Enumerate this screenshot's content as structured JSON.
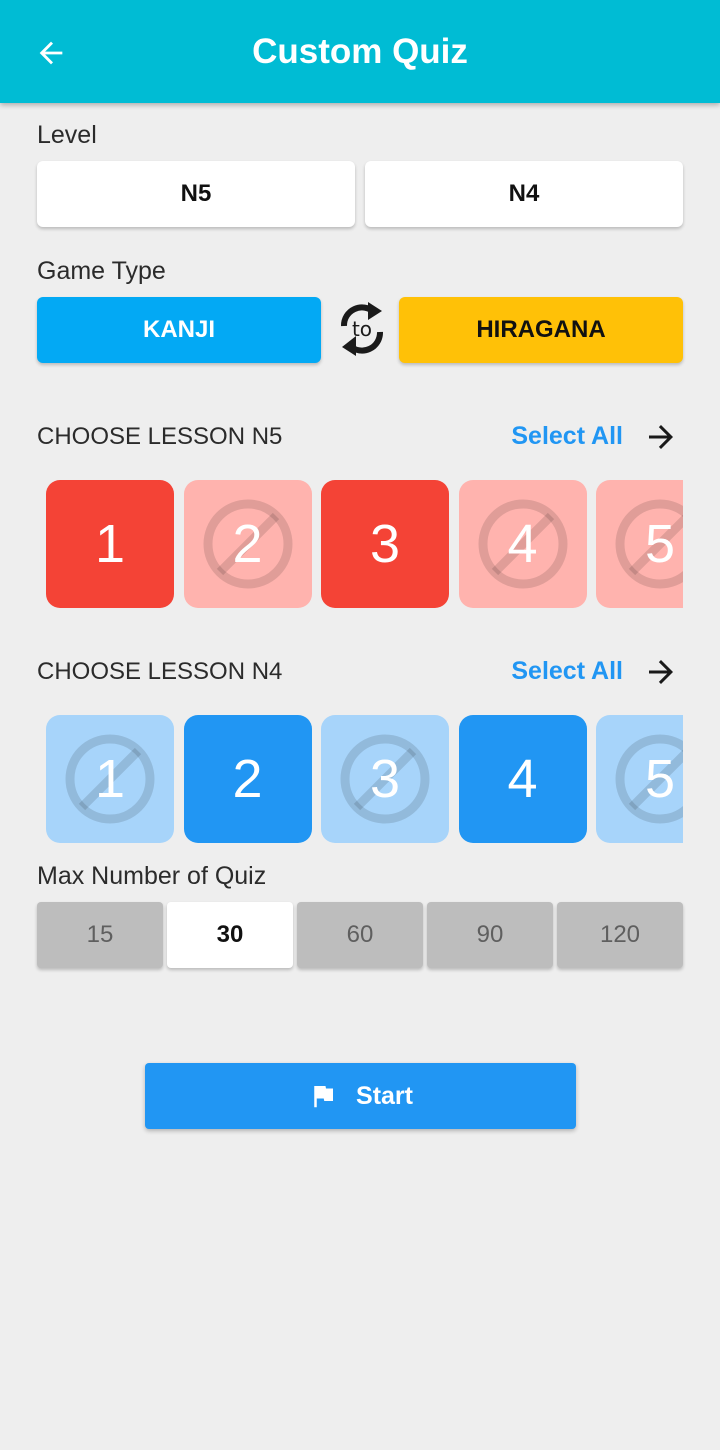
{
  "header": {
    "title": "Custom Quiz",
    "back_icon": "arrow-left-icon"
  },
  "level": {
    "label": "Level",
    "options": [
      "N5",
      "N4"
    ]
  },
  "game_type": {
    "label": "Game Type",
    "from": "KANJI",
    "to": "HIRAGANA",
    "swap_text": "to"
  },
  "lessons_n5": {
    "title": "CHOOSE LESSON N5",
    "select_all": "Select All",
    "items": [
      {
        "label": "1",
        "selected": true
      },
      {
        "label": "2",
        "selected": false
      },
      {
        "label": "3",
        "selected": true
      },
      {
        "label": "4",
        "selected": false
      },
      {
        "label": "5",
        "selected": false
      }
    ]
  },
  "lessons_n4": {
    "title": "CHOOSE LESSON N4",
    "select_all": "Select All",
    "items": [
      {
        "label": "1",
        "selected": false
      },
      {
        "label": "2",
        "selected": true
      },
      {
        "label": "3",
        "selected": false
      },
      {
        "label": "4",
        "selected": true
      },
      {
        "label": "5",
        "selected": false
      }
    ]
  },
  "max_quiz": {
    "label": "Max Number of Quiz",
    "options": [
      "15",
      "30",
      "60",
      "90",
      "120"
    ],
    "selected": "30"
  },
  "start": {
    "label": "Start",
    "icon": "flag-icon"
  },
  "colors": {
    "appbar": "#00bcd4",
    "kanji": "#03a9f4",
    "hiragana": "#ffc107",
    "n5_selected": "#f44336",
    "n5_unselected": "#ffb3ae",
    "n4_selected": "#2196f3",
    "n4_unselected": "#a7d4fa",
    "accent": "#2196f3"
  }
}
